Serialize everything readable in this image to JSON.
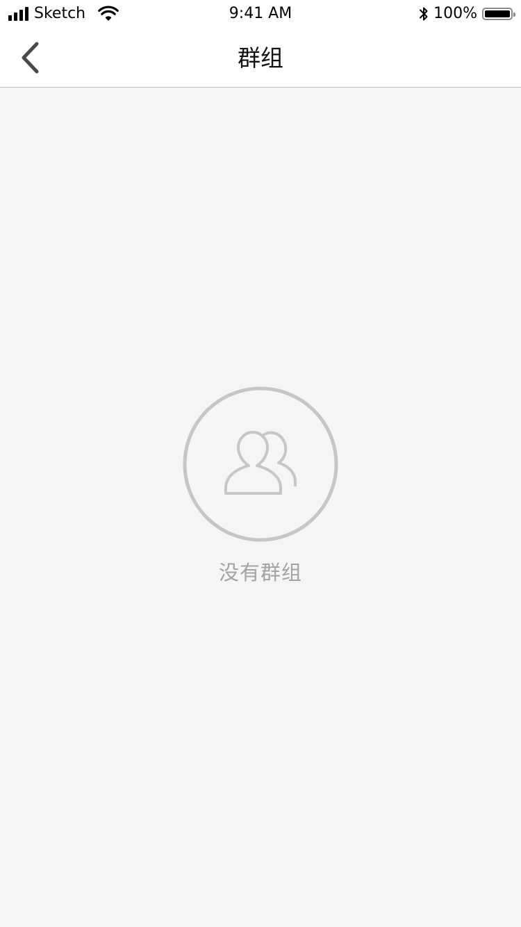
{
  "status_bar": {
    "carrier": "Sketch",
    "time": "9:41 AM",
    "battery_percent": "100%",
    "battery_level": 1.0,
    "signal_strength": 4,
    "icons": [
      "signal-icon",
      "wifi-icon",
      "bluetooth-icon",
      "battery-icon"
    ]
  },
  "nav_bar": {
    "title": "群组",
    "back_icon": "chevron-left-icon"
  },
  "empty_state": {
    "icon": "group-icon",
    "message": "没有群组"
  },
  "colors": {
    "background": "#f5f5f5",
    "nav_background": "#ffffff",
    "nav_divider": "#b7c4c4",
    "icon_gray": "#c6c6c6",
    "empty_text": "#a3a3a3",
    "back_icon": "#4a4a4a"
  }
}
